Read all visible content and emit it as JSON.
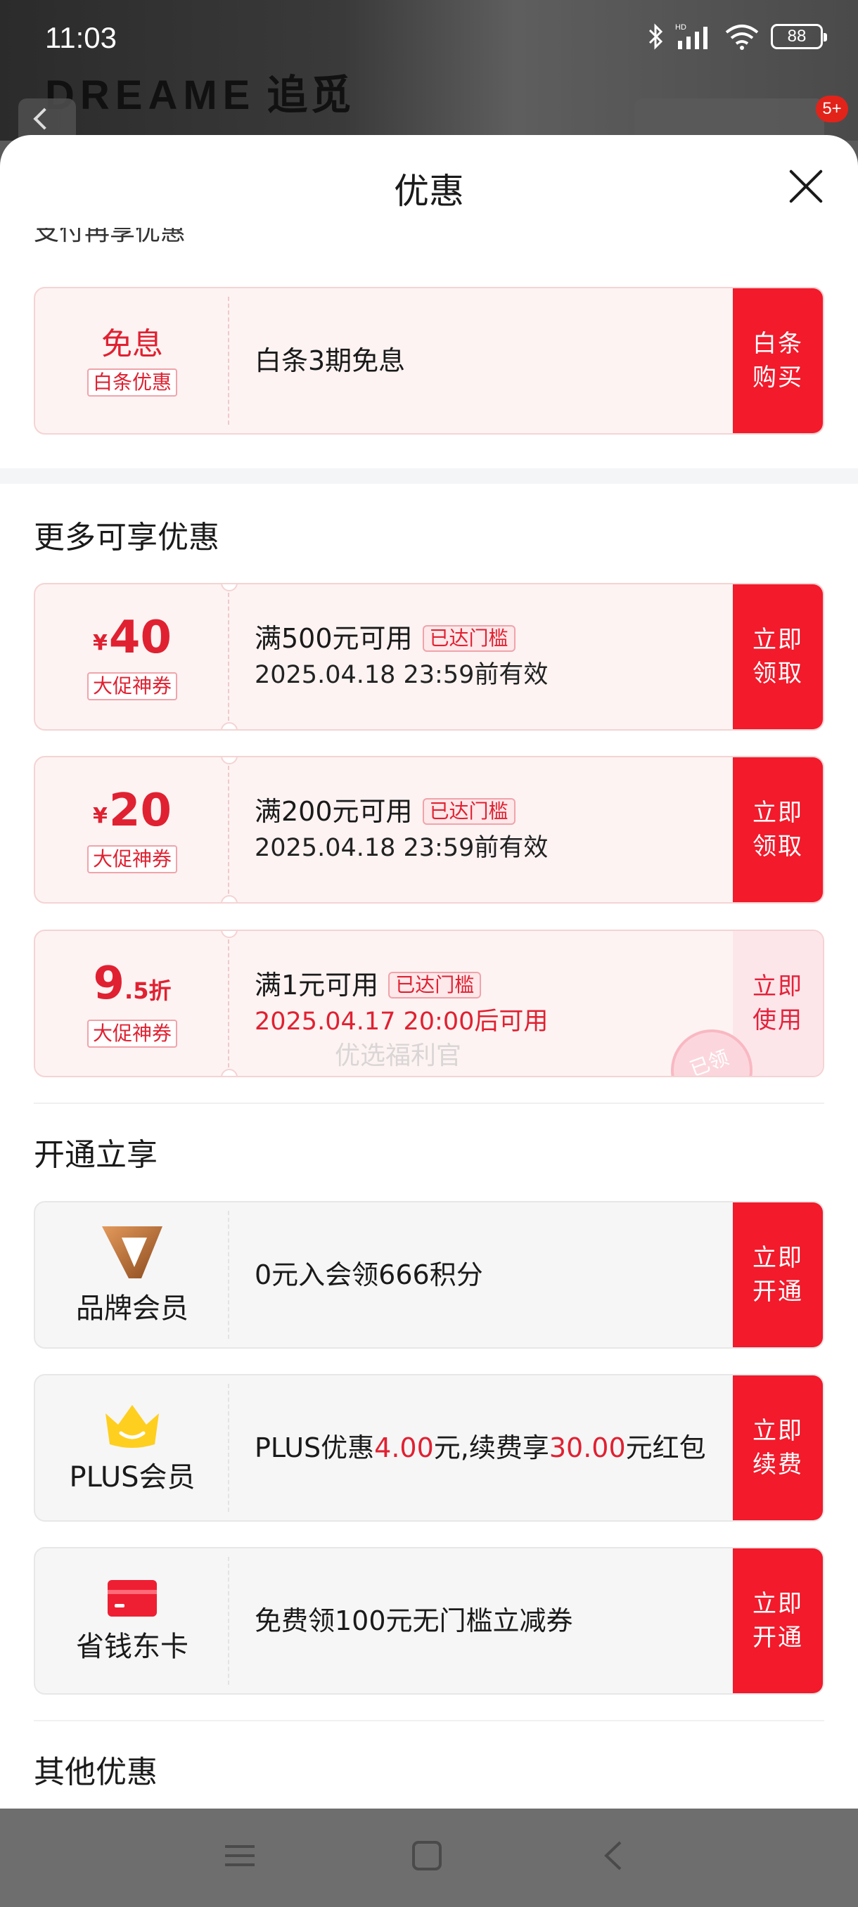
{
  "status_bar": {
    "time": "11:03",
    "battery": "88"
  },
  "background_app": {
    "brand_logo": "DREAME",
    "brand_logo_cn": "追觅",
    "badge": "5+"
  },
  "sheet": {
    "title": "优惠",
    "clipped_section_title": "支付再享优惠",
    "baitiao": {
      "left_title": "免息",
      "left_tag": "白条优惠",
      "desc": "白条3期免息",
      "action": "白条\n购买"
    },
    "more_section_title": "更多可享优惠",
    "coupons": [
      {
        "currency": "¥",
        "amount": "40",
        "tag": "大促神券",
        "condition": "满500元可用",
        "threshold": "已达门槛",
        "validity": "2025.04.18 23:59前有效",
        "action": "立即\n领取"
      },
      {
        "currency": "¥",
        "amount": "20",
        "tag": "大促神券",
        "condition": "满200元可用",
        "threshold": "已达门槛",
        "validity": "2025.04.18 23:59前有效",
        "action": "立即\n领取"
      },
      {
        "discount_main": "9",
        "discount_dec": ".5折",
        "tag": "大促神券",
        "condition": "满1元可用",
        "threshold": "已达门槛",
        "validity": "2025.04.17 20:00后可用",
        "action": "立即\n使用",
        "stamp": "已领"
      }
    ],
    "watermark": "优选福利官",
    "open_section_title": "开通立享",
    "memberships": [
      {
        "icon": "brand-v-icon",
        "label": "品牌会员",
        "desc": "0元入会领666积分",
        "action": "立即\n开通"
      },
      {
        "icon": "crown-icon",
        "label": "PLUS会员",
        "desc_prefix": "PLUS优惠",
        "desc_amount1": "4.00",
        "desc_mid": "元,续费享",
        "desc_amount2": "30.00",
        "desc_suffix": "元红包",
        "action": "立即\n续费"
      },
      {
        "icon": "card-icon",
        "label": "省钱东卡",
        "desc": "免费领100元无门槛立减券",
        "action": "立即\n开通"
      }
    ],
    "other_section_title": "其他优惠"
  },
  "colors": {
    "accent": "#f21a2b",
    "coupon_bg": "#fdf3f3",
    "member_bg": "#f6f6f7",
    "price_red": "#e02131"
  }
}
